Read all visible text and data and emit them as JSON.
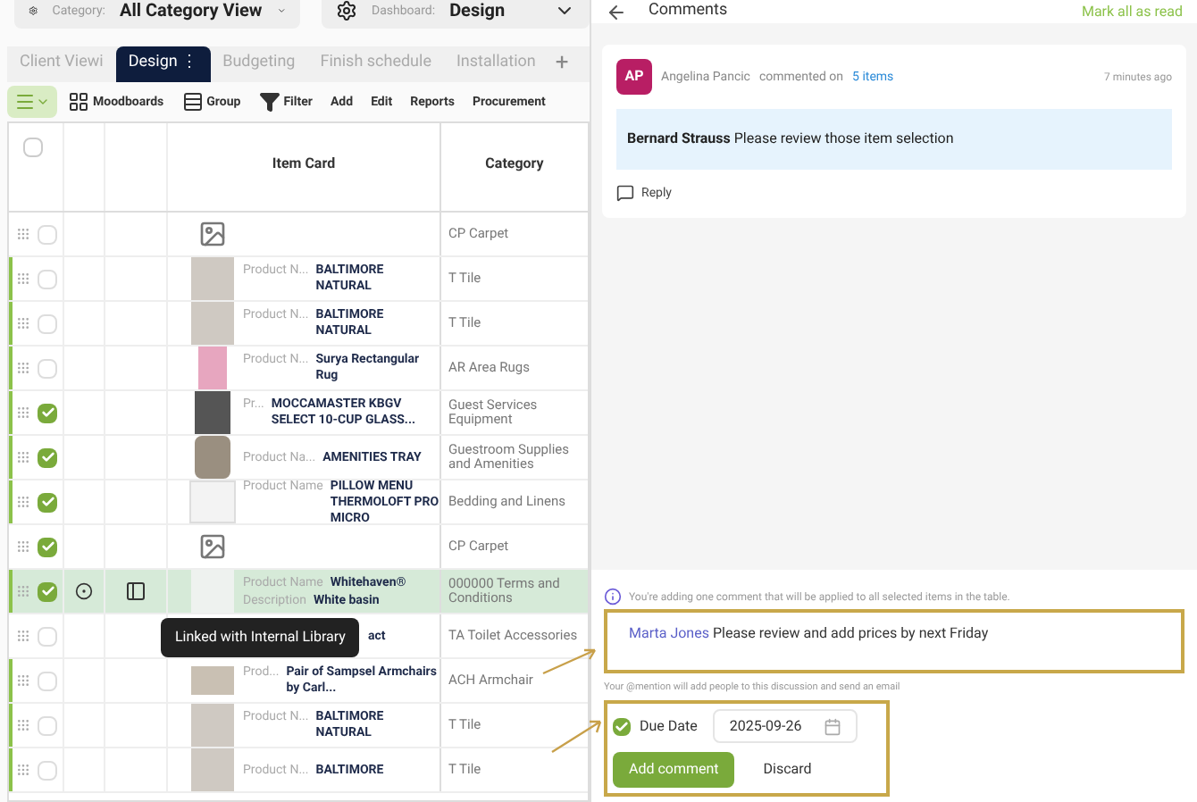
{
  "filters": [
    {
      "label": "Category:",
      "value": "All Category View"
    },
    {
      "label": "Dashboard:",
      "value": "Design"
    }
  ],
  "tabs": [
    {
      "label": "Client Viewi",
      "selected": false
    },
    {
      "label": "Design",
      "selected": true,
      "menu": "⋮"
    },
    {
      "label": "Budgeting",
      "selected": false
    },
    {
      "label": "Finish schedule",
      "selected": false
    },
    {
      "label": "Installation",
      "selected": false
    }
  ],
  "add_tab": "+",
  "toolbar": [
    {
      "kind": "icon",
      "label": "Moodboards"
    },
    {
      "kind": "icon",
      "label": "Group"
    },
    {
      "kind": "icon",
      "label": "Filter"
    },
    {
      "kind": "text",
      "label": "Add"
    },
    {
      "kind": "text",
      "label": "Edit"
    },
    {
      "kind": "text",
      "label": "Reports"
    },
    {
      "kind": "text",
      "label": "Procurement"
    }
  ],
  "table": {
    "select_all": {
      "checked": false
    },
    "columns": [
      "Item Card",
      "Category"
    ],
    "rows": [
      {
        "checked": false,
        "accent": false,
        "selected": false,
        "kind": "placeholder",
        "category": "CP Carpet"
      },
      {
        "checked": false,
        "accent": true,
        "selected": false,
        "kind": "tile",
        "label": "Product N...",
        "name": "BALTIMORE NATURAL",
        "category": "T Tile"
      },
      {
        "checked": false,
        "accent": true,
        "selected": false,
        "kind": "tile",
        "label": "Product N...",
        "name": "BALTIMORE NATURAL",
        "category": "T Tile"
      },
      {
        "checked": false,
        "accent": true,
        "selected": false,
        "kind": "rug",
        "label": "Product N...",
        "name": "Surya Rectangular Rug",
        "category": "AR Area Rugs"
      },
      {
        "checked": true,
        "accent": true,
        "selected": false,
        "kind": "machine",
        "label": "Pr...",
        "name": "MOCCAMASTER KBGV SELECT 10-CUP GLASS...",
        "category": "Guest Services Equipment"
      },
      {
        "checked": true,
        "accent": true,
        "selected": false,
        "kind": "tray",
        "label": "Product Na...",
        "name": "AMENITIES TRAY",
        "category": "Guestroom Supplies and Amenities"
      },
      {
        "checked": true,
        "accent": true,
        "selected": false,
        "kind": "pillow",
        "label": "Product Name",
        "name": "PILLOW MENU THERMOLOFT PRO MICRO",
        "category": "Bedding and Linens"
      },
      {
        "checked": true,
        "accent": false,
        "selected": false,
        "kind": "placeholder",
        "category": "CP Carpet"
      },
      {
        "checked": true,
        "accent": true,
        "selected": true,
        "kind": "basin",
        "label": "Product Name",
        "name": "Whitehaven®",
        "desc_label": "Description",
        "desc": "White basin",
        "category": "000000 Terms and Conditions"
      },
      {
        "checked": false,
        "accent": false,
        "selected": false,
        "kind": "covered",
        "name": "act",
        "category": "TA Toilet Accessories"
      },
      {
        "checked": false,
        "accent": true,
        "selected": false,
        "kind": "chairs",
        "label": "Prod...",
        "name": "Pair of Sampsel Armchairs by Carl...",
        "category": "ACH Armchair"
      },
      {
        "checked": false,
        "accent": true,
        "selected": false,
        "kind": "tile",
        "label": "Product N...",
        "name": "BALTIMORE NATURAL",
        "category": "T Tile"
      },
      {
        "checked": false,
        "accent": true,
        "selected": false,
        "kind": "tile",
        "label": "Product N...",
        "name": "BALTIMORE",
        "category": "T Tile"
      }
    ]
  },
  "tooltip": "Linked with Internal Library",
  "comments": {
    "title": "Comments",
    "mark_all": "Mark all as read",
    "comment": {
      "initials": "AP",
      "author": "Angelina Pancic",
      "action": "commented on",
      "link": "5 items",
      "time": "7 minutes ago",
      "mention": "Bernard Strauss",
      "text": "Please review those item selection",
      "reply": "Reply"
    },
    "info": "You're adding one comment that will be applied to all selected items in the table.",
    "draft": {
      "mention": "Marta Jones",
      "text": "Please review and add prices by next Friday"
    },
    "hint": "Your @mention will add people to this discussion and send an email",
    "due": {
      "checked": true,
      "label": "Due Date",
      "value": "2025-09-26"
    },
    "submit": "Add comment",
    "discard": "Discard"
  }
}
